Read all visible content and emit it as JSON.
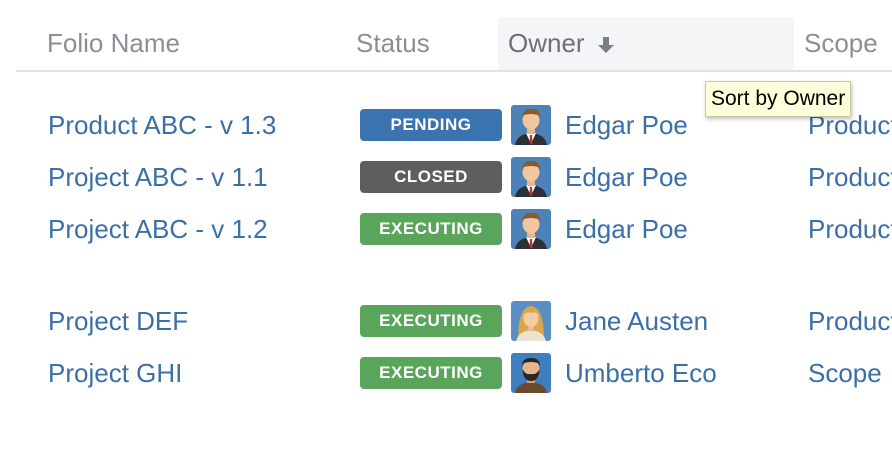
{
  "header": {
    "folio_name": "Folio Name",
    "status": "Status",
    "owner": "Owner",
    "scope": "Scope",
    "sort_icon": "arrow-down-icon"
  },
  "tooltip": "Sort by Owner",
  "colors": {
    "link": "#3b6fa8",
    "header_text": "#8a8f96",
    "pending": "#3b73af",
    "closed": "#5e5e5e",
    "executing": "#59a55c",
    "tooltip_bg": "#ffffdc"
  },
  "rows": [
    {
      "name": "Product ABC - v 1.3",
      "status": "PENDING",
      "owner": "Edgar Poe",
      "avatar": "man-suit-avatar-icon",
      "scope": "Product"
    },
    {
      "name": "Project ABC - v 1.1",
      "status": "CLOSED",
      "owner": "Edgar Poe",
      "avatar": "man-suit-avatar-icon",
      "scope": "Product"
    },
    {
      "name": "Project ABC - v 1.2",
      "status": "EXECUTING",
      "owner": "Edgar Poe",
      "avatar": "man-suit-avatar-icon",
      "scope": "Product"
    },
    {
      "name": "Project DEF",
      "status": "EXECUTING",
      "owner": "Jane Austen",
      "avatar": "woman-avatar-icon",
      "scope": "Product"
    },
    {
      "name": "Project GHI",
      "status": "EXECUTING",
      "owner": "Umberto Eco",
      "avatar": "bearded-man-avatar-icon",
      "scope": "Scope"
    }
  ]
}
